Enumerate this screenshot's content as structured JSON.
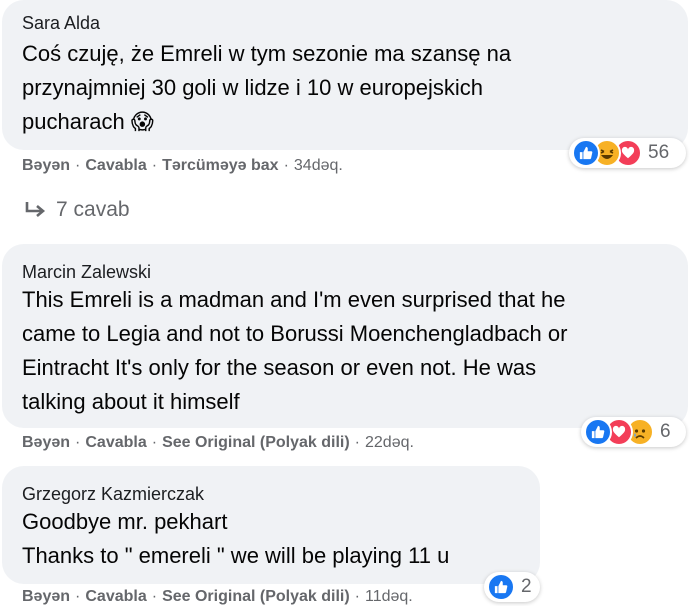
{
  "comments": [
    {
      "author": "Sara Alda",
      "lines": [
        "Coś czuję, że Emreli w tym sezonie ma szansę na",
        "przynajmniej 30 goli w lidze i 10 w europejskich",
        "pucharach 😱"
      ],
      "actions": {
        "like": "Bəyən",
        "reply": "Cavabla",
        "translate": "Tərcüməyə bax",
        "time": "34dəq."
      },
      "reactions": {
        "icons": [
          "like-icon",
          "haha-icon",
          "love-icon"
        ],
        "count": "56"
      },
      "replies": "7 cavab"
    },
    {
      "author": "Marcin Zalewski",
      "lines": [
        "This Emreli is a madman and I'm even surprised that he",
        "came to Legia and not to Borussi Moenchengladbach or",
        "Eintracht It's only for the season or even not. He was",
        "talking about it himself"
      ],
      "actions": {
        "like": "Bəyən",
        "reply": "Cavabla",
        "translate": "See Original (Polyak dili)",
        "time": "22dəq."
      },
      "reactions": {
        "icons": [
          "like-icon",
          "love-icon",
          "sad-icon"
        ],
        "count": "6"
      }
    },
    {
      "author": "Grzegorz Kazmierczak",
      "lines": [
        "Goodbye mr. pekhart",
        "Thanks to \" emereli \" we will be playing 11 u"
      ],
      "actions": {
        "like": "Bəyən",
        "reply": "Cavabla",
        "translate": "See Original (Polyak dili)",
        "time": "11dəq."
      },
      "reactions": {
        "icons": [
          "like-icon"
        ],
        "count": "2"
      }
    }
  ],
  "separator": "·",
  "colors": {
    "bubble": "#f0f2f5",
    "meta_text": "#65676b",
    "like_blue": "#1877f2",
    "love_red": "#f33e58",
    "haha_yellow": "#f7b125"
  }
}
